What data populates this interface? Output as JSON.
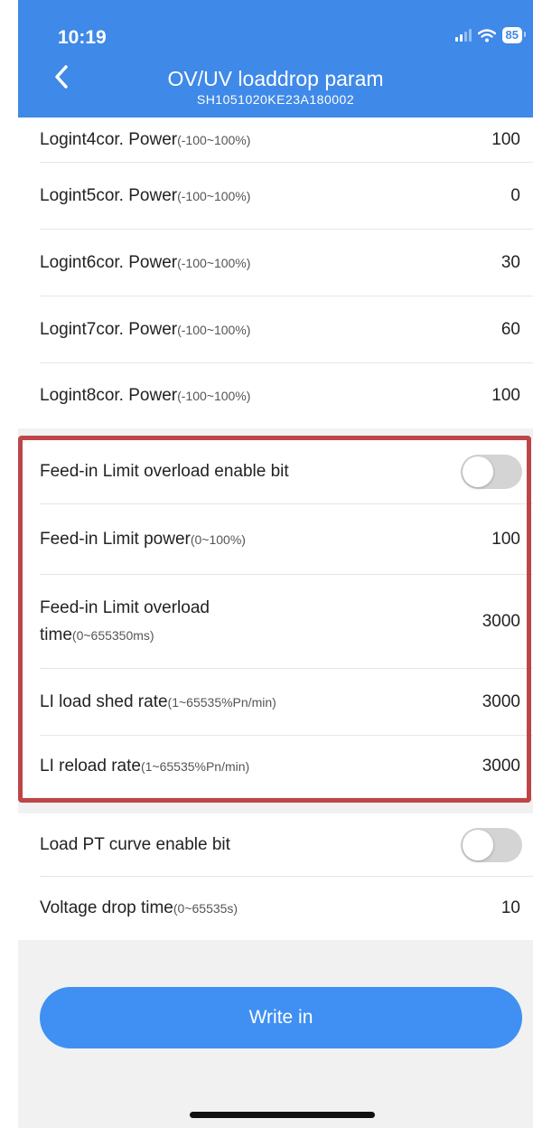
{
  "status_bar": {
    "time": "10:19",
    "battery": "85"
  },
  "header": {
    "title": "OV/UV loaddrop param",
    "subtitle": "SH1051020KE23A180002"
  },
  "group1": {
    "rows": [
      {
        "label": "Logint4cor. Power",
        "range": "(-100~100%)",
        "value": "100"
      },
      {
        "label": "Logint5cor. Power",
        "range": "(-100~100%)",
        "value": "0"
      },
      {
        "label": "Logint6cor. Power",
        "range": "(-100~100%)",
        "value": "30"
      },
      {
        "label": "Logint7cor. Power",
        "range": "(-100~100%)",
        "value": "60"
      },
      {
        "label": "Logint8cor. Power",
        "range": "(-100~100%)",
        "value": "100"
      }
    ]
  },
  "group2": {
    "enable": {
      "label": "Feed-in Limit overload enable bit",
      "enabled": false
    },
    "power": {
      "label": "Feed-in Limit power",
      "range": "(0~100%)",
      "value": "100"
    },
    "overload_time": {
      "label_line1": "Feed-in Limit overload",
      "label_line2": "time",
      "range": "(0~655350ms)",
      "value": "3000"
    },
    "shed_rate": {
      "label": "LI load shed rate",
      "range": "(1~65535%Pn/min)",
      "value": "3000"
    },
    "reload_rate": {
      "label": "LI reload rate",
      "range": "(1~65535%Pn/min)",
      "value": "3000"
    }
  },
  "group3": {
    "pt_curve": {
      "label": "Load PT curve enable bit",
      "enabled": false
    },
    "drop_time": {
      "label": "Voltage drop time",
      "range": "(0~65535s)",
      "value": "10"
    }
  },
  "footer": {
    "write_label": "Write in"
  },
  "colors": {
    "header": "#3f89e8",
    "button": "#3f90f2",
    "highlight": "#bd4548",
    "toggle_off": "#d4d4d4"
  }
}
